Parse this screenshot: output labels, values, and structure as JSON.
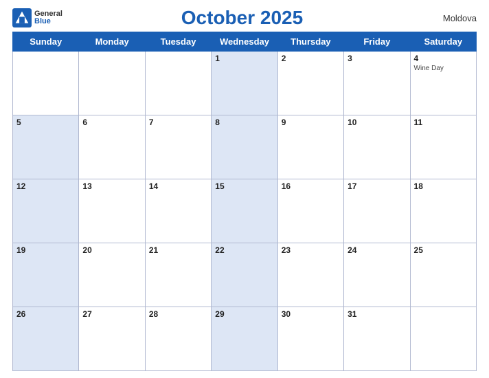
{
  "header": {
    "logo": {
      "general": "General",
      "blue": "Blue",
      "icon_label": "generalblue-logo"
    },
    "title": "October 2025",
    "country": "Moldova"
  },
  "weekdays": [
    "Sunday",
    "Monday",
    "Tuesday",
    "Wednesday",
    "Thursday",
    "Friday",
    "Saturday"
  ],
  "weeks": [
    [
      {
        "day": "",
        "event": "",
        "blue": false
      },
      {
        "day": "",
        "event": "",
        "blue": false
      },
      {
        "day": "",
        "event": "",
        "blue": false
      },
      {
        "day": "1",
        "event": "",
        "blue": true
      },
      {
        "day": "2",
        "event": "",
        "blue": false
      },
      {
        "day": "3",
        "event": "",
        "blue": false
      },
      {
        "day": "4",
        "event": "Wine Day",
        "blue": false
      }
    ],
    [
      {
        "day": "5",
        "event": "",
        "blue": true
      },
      {
        "day": "6",
        "event": "",
        "blue": false
      },
      {
        "day": "7",
        "event": "",
        "blue": false
      },
      {
        "day": "8",
        "event": "",
        "blue": true
      },
      {
        "day": "9",
        "event": "",
        "blue": false
      },
      {
        "day": "10",
        "event": "",
        "blue": false
      },
      {
        "day": "11",
        "event": "",
        "blue": false
      }
    ],
    [
      {
        "day": "12",
        "event": "",
        "blue": true
      },
      {
        "day": "13",
        "event": "",
        "blue": false
      },
      {
        "day": "14",
        "event": "",
        "blue": false
      },
      {
        "day": "15",
        "event": "",
        "blue": true
      },
      {
        "day": "16",
        "event": "",
        "blue": false
      },
      {
        "day": "17",
        "event": "",
        "blue": false
      },
      {
        "day": "18",
        "event": "",
        "blue": false
      }
    ],
    [
      {
        "day": "19",
        "event": "",
        "blue": true
      },
      {
        "day": "20",
        "event": "",
        "blue": false
      },
      {
        "day": "21",
        "event": "",
        "blue": false
      },
      {
        "day": "22",
        "event": "",
        "blue": true
      },
      {
        "day": "23",
        "event": "",
        "blue": false
      },
      {
        "day": "24",
        "event": "",
        "blue": false
      },
      {
        "day": "25",
        "event": "",
        "blue": false
      }
    ],
    [
      {
        "day": "26",
        "event": "",
        "blue": true
      },
      {
        "day": "27",
        "event": "",
        "blue": false
      },
      {
        "day": "28",
        "event": "",
        "blue": false
      },
      {
        "day": "29",
        "event": "",
        "blue": true
      },
      {
        "day": "30",
        "event": "",
        "blue": false
      },
      {
        "day": "31",
        "event": "",
        "blue": false
      },
      {
        "day": "",
        "event": "",
        "blue": false
      }
    ]
  ]
}
